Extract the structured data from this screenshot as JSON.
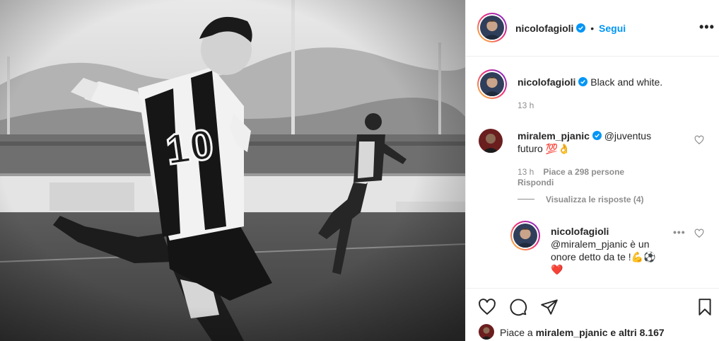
{
  "header": {
    "username": "nicolofagioli",
    "separator": "•",
    "follow_label": "Segui",
    "more_label": "•••"
  },
  "caption": {
    "username": "nicolofagioli",
    "text": "Black and white.",
    "time": "13 h"
  },
  "comments": [
    {
      "username": "miralem_pjanic",
      "text_line1": "@juventus",
      "text_line2": "futuro 💯👌",
      "time": "13 h",
      "likes": "Piace a 298 persone",
      "reply_label": "Rispondi"
    },
    {
      "username": "nicolofagioli",
      "text_line1": "@miralem_pjanic è un",
      "text_line2": "onore detto da te !💪⚽",
      "text_line3": "❤️"
    }
  ],
  "view_replies": "Visualizza le risposte (4)",
  "likes_bar": {
    "prefix": "Piace a",
    "user": "miralem_pjanic",
    "suffix": "e altri 8.167"
  },
  "icons": {
    "verified": "verified-badge-icon",
    "like": "heart-icon",
    "comment": "comment-icon",
    "share": "paper-plane-icon",
    "save": "bookmark-icon"
  },
  "colors": {
    "accent": "#0095f6",
    "text": "#262626",
    "muted": "#8e8e8e",
    "border": "#efefef"
  },
  "photo": {
    "shirt_number": "10"
  }
}
